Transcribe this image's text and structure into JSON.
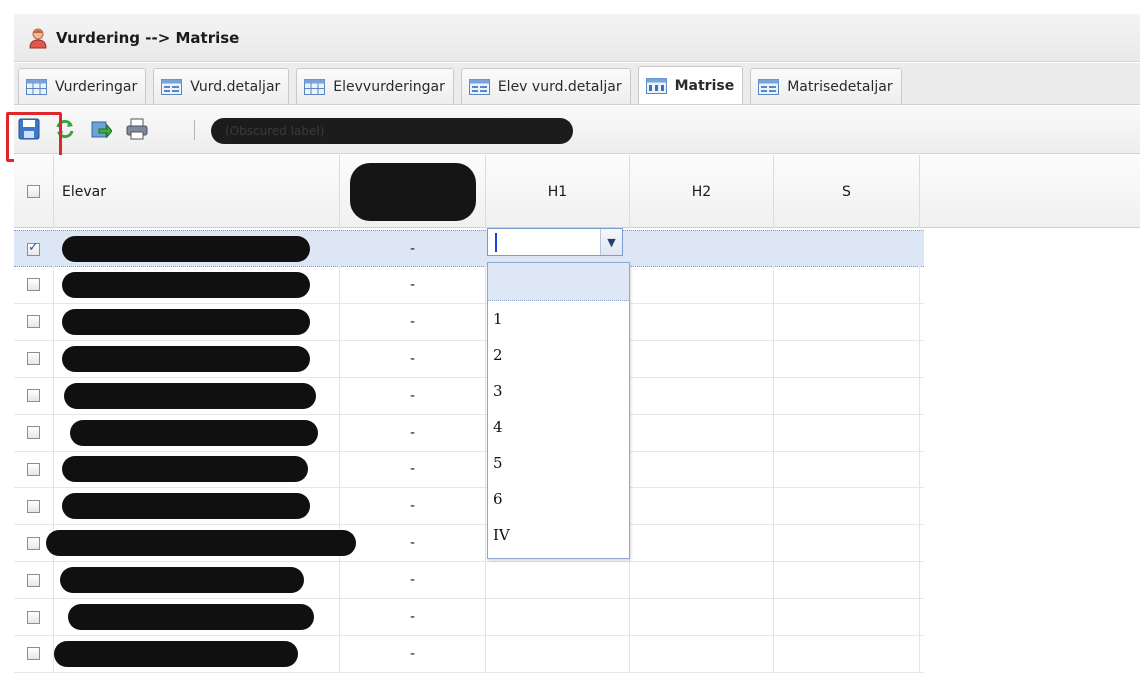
{
  "window": {
    "title": "Vurdering --> Matrise"
  },
  "tabs": [
    {
      "label": "Vurderingar",
      "icon": "table-icon",
      "active": false
    },
    {
      "label": "Vurd.detaljar",
      "icon": "form-icon",
      "active": false
    },
    {
      "label": "Elevvurderingar",
      "icon": "table-icon",
      "active": false
    },
    {
      "label": "Elev vurd.detaljar",
      "icon": "form-icon",
      "active": false
    },
    {
      "label": "Matrise",
      "icon": "matrix-icon",
      "active": true
    },
    {
      "label": "Matrisedetaljar",
      "icon": "form-icon",
      "active": false
    }
  ],
  "toolbar": {
    "buttons": [
      "save-icon",
      "refresh-icon",
      "export-icon",
      "print-icon"
    ],
    "label": "(Obscured label)"
  },
  "grid": {
    "columns": [
      {
        "key": "check",
        "label": ""
      },
      {
        "key": "elevar",
        "label": "Elevar"
      },
      {
        "key": "hv",
        "label": ""
      },
      {
        "key": "h1",
        "label": "H1"
      },
      {
        "key": "h2",
        "label": "H2"
      },
      {
        "key": "s",
        "label": "S"
      }
    ],
    "rows": [
      {
        "checked": true,
        "value": "-"
      },
      {
        "checked": false,
        "value": "-"
      },
      {
        "checked": false,
        "value": "-"
      },
      {
        "checked": false,
        "value": "-"
      },
      {
        "checked": false,
        "value": "-"
      },
      {
        "checked": false,
        "value": "-"
      },
      {
        "checked": false,
        "value": "-"
      },
      {
        "checked": false,
        "value": "-"
      },
      {
        "checked": false,
        "value": "-"
      },
      {
        "checked": false,
        "value": "-"
      },
      {
        "checked": false,
        "value": "-"
      },
      {
        "checked": false,
        "value": "-"
      }
    ]
  },
  "combo": {
    "value": ""
  },
  "dropdown": {
    "options": [
      "",
      "1",
      "2",
      "3",
      "4",
      "5",
      "6",
      "IV"
    ]
  }
}
